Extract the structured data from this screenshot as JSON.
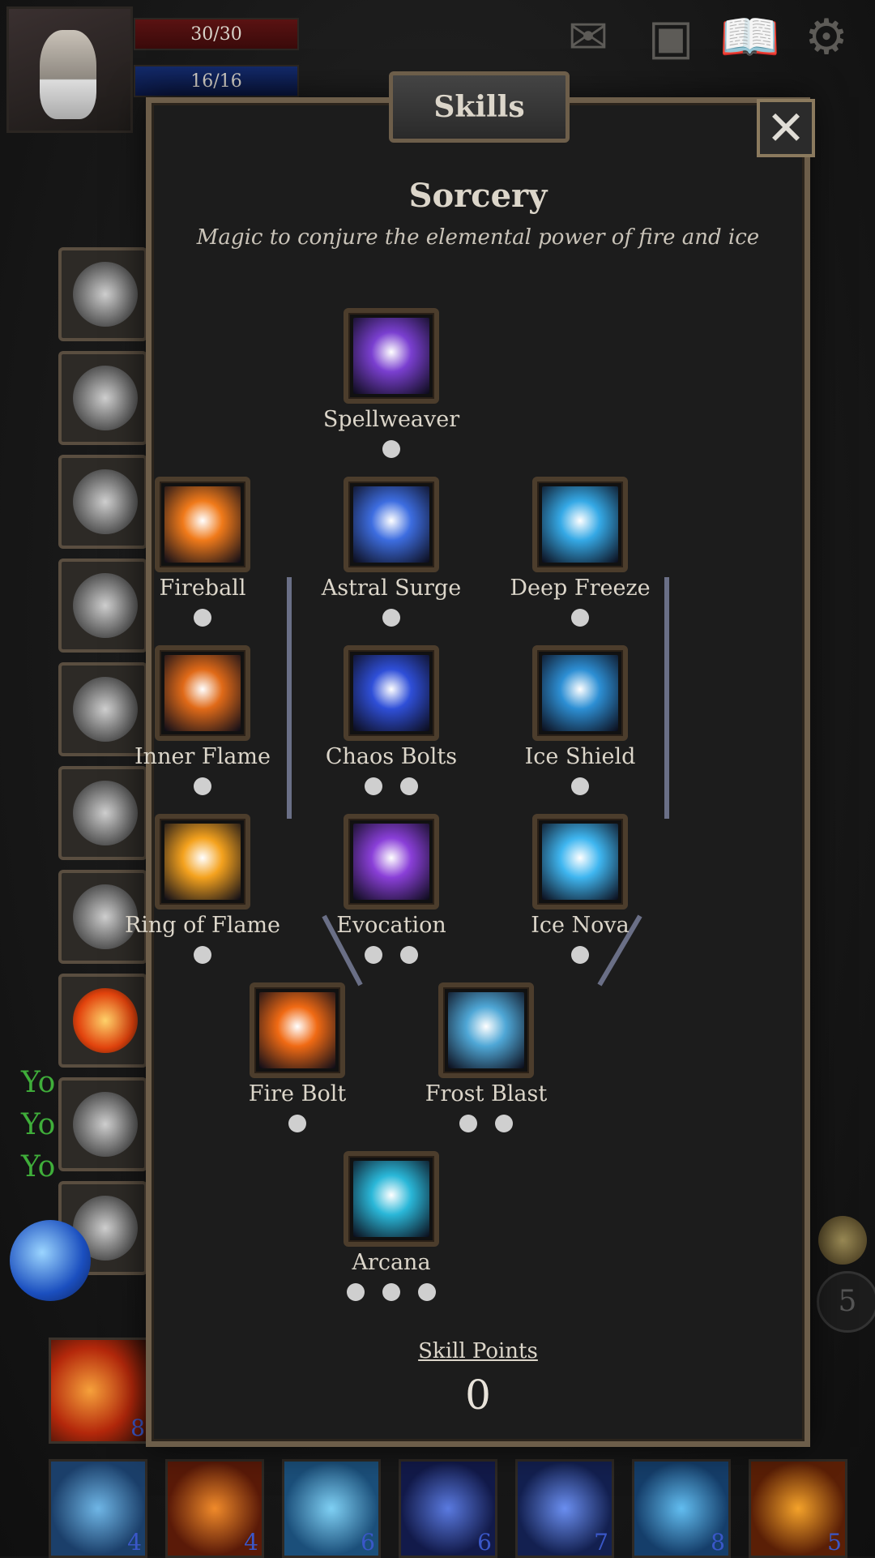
{
  "hud": {
    "hp": "30/30",
    "mp": "16/16",
    "top_icons": [
      "map-icon",
      "inventory-icon",
      "book-icon",
      "gear-icon"
    ]
  },
  "chat_lines": [
    "Yo",
    "Yo",
    "Yo"
  ],
  "side_counter": "5",
  "hotbar": {
    "left_slot_count": "8",
    "bottom_counts": [
      "4",
      "4",
      "6",
      "6",
      "7",
      "8",
      "5"
    ]
  },
  "panel": {
    "tab_title": "Skills",
    "close_label": "✕",
    "tree_title": "Sorcery",
    "tree_subtitle": "Magic to conjure the elemental power of fire and ice",
    "skill_points_label": "Skill Points",
    "skill_points_value": "0"
  },
  "skills": [
    {
      "key": "spellweaver",
      "label": "Spellweaver",
      "ranks": 1,
      "color": "#7a3fd0"
    },
    {
      "key": "fireball",
      "label": "Fireball",
      "ranks": 1,
      "color": "#f07a1a"
    },
    {
      "key": "astral_surge",
      "label": "Astral Surge",
      "ranks": 1,
      "color": "#3d6de0"
    },
    {
      "key": "deep_freeze",
      "label": "Deep Freeze",
      "ranks": 1,
      "color": "#35a9e6"
    },
    {
      "key": "inner_flame",
      "label": "Inner Flame",
      "ranks": 1,
      "color": "#e06a18"
    },
    {
      "key": "chaos_bolts",
      "label": "Chaos Bolts",
      "ranks": 2,
      "color": "#2f4fd8"
    },
    {
      "key": "ice_shield",
      "label": "Ice Shield",
      "ranks": 1,
      "color": "#2d8fd4"
    },
    {
      "key": "ring_of_flame",
      "label": "Ring of Flame",
      "ranks": 1,
      "color": "#f4a21e"
    },
    {
      "key": "evocation",
      "label": "Evocation",
      "ranks": 2,
      "color": "#8a3fd8"
    },
    {
      "key": "ice_nova",
      "label": "Ice Nova",
      "ranks": 1,
      "color": "#3fb6f0"
    },
    {
      "key": "fire_bolt",
      "label": "Fire Bolt",
      "ranks": 1,
      "color": "#f06a14"
    },
    {
      "key": "frost_blast",
      "label": "Frost Blast",
      "ranks": 2,
      "color": "#4fa7d6"
    },
    {
      "key": "arcana",
      "label": "Arcana",
      "ranks": 3,
      "color": "#2ab7d8"
    }
  ]
}
